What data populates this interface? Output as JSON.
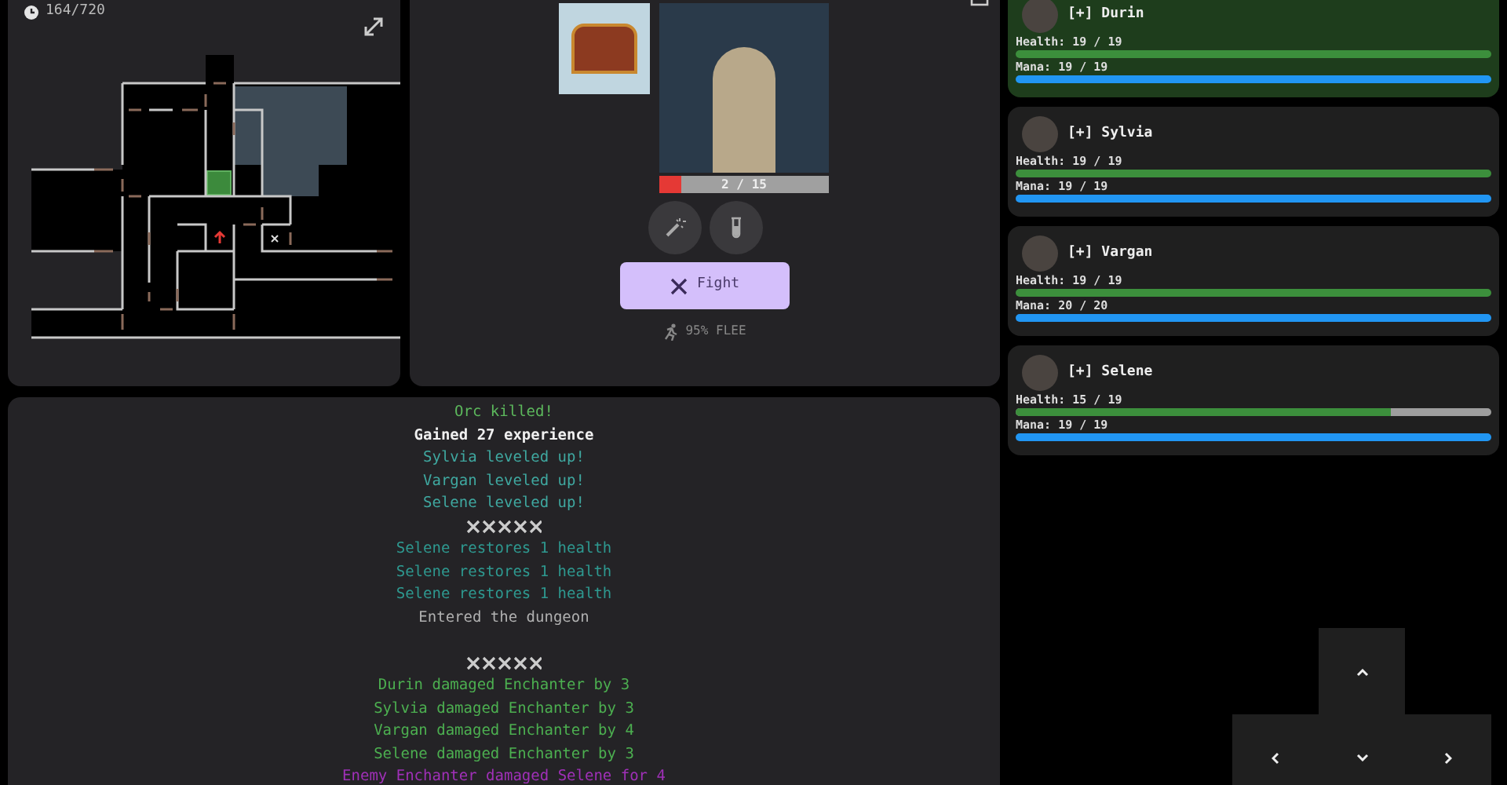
{
  "map_panel": {
    "turns": "164/720"
  },
  "battle": {
    "enemy_health": {
      "text": "2 / 15",
      "level": 0.133
    },
    "fight_label": "Fight",
    "flee_label": "95% FLEE"
  },
  "log": [
    {
      "kind": "kill",
      "text": "Orc killed!"
    },
    {
      "kind": "experience",
      "text": "Gained 27 experience"
    },
    {
      "kind": "level",
      "text": "Sylvia leveled up!"
    },
    {
      "kind": "level",
      "text": "Vargan leveled up!"
    },
    {
      "kind": "level",
      "text": "Selene leveled up!"
    },
    {
      "kind": "separator"
    },
    {
      "kind": "restore",
      "text": "Selene restores 1 health"
    },
    {
      "kind": "restore",
      "text": "Selene restores 1 health"
    },
    {
      "kind": "restore",
      "text": "Selene restores 1 health"
    },
    {
      "kind": "info",
      "text": "Entered the dungeon"
    },
    {
      "kind": "blank"
    },
    {
      "kind": "separator"
    },
    {
      "kind": "damage",
      "text": "Durin damaged Enchanter by 3"
    },
    {
      "kind": "damage",
      "text": "Sylvia damaged Enchanter by 3"
    },
    {
      "kind": "damage",
      "text": "Vargan damaged Enchanter by 4"
    },
    {
      "kind": "damage",
      "text": "Selene damaged Enchanter by 3"
    },
    {
      "kind": "enemy",
      "text": "Enemy Enchanter damaged Selene for 4"
    }
  ],
  "party": [
    {
      "name": "[+] Durin",
      "selected": true,
      "health": {
        "text": "Health: 19 / 19",
        "level": 1
      },
      "mana": {
        "text": "Mana: 19 / 19",
        "level": 1
      }
    },
    {
      "name": "[+] Sylvia",
      "selected": false,
      "health": {
        "text": "Health: 19 / 19",
        "level": 1
      },
      "mana": {
        "text": "Mana: 19 / 19",
        "level": 1
      }
    },
    {
      "name": "[+] Vargan",
      "selected": false,
      "health": {
        "text": "Health: 19 / 19",
        "level": 1
      },
      "mana": {
        "text": "Mana: 20 / 20",
        "level": 1
      }
    },
    {
      "name": "[+] Selene",
      "selected": false,
      "health": {
        "text": "Health: 15 / 19",
        "level": 0.789
      },
      "mana": {
        "text": "Mana: 19 / 19",
        "level": 1
      }
    }
  ]
}
